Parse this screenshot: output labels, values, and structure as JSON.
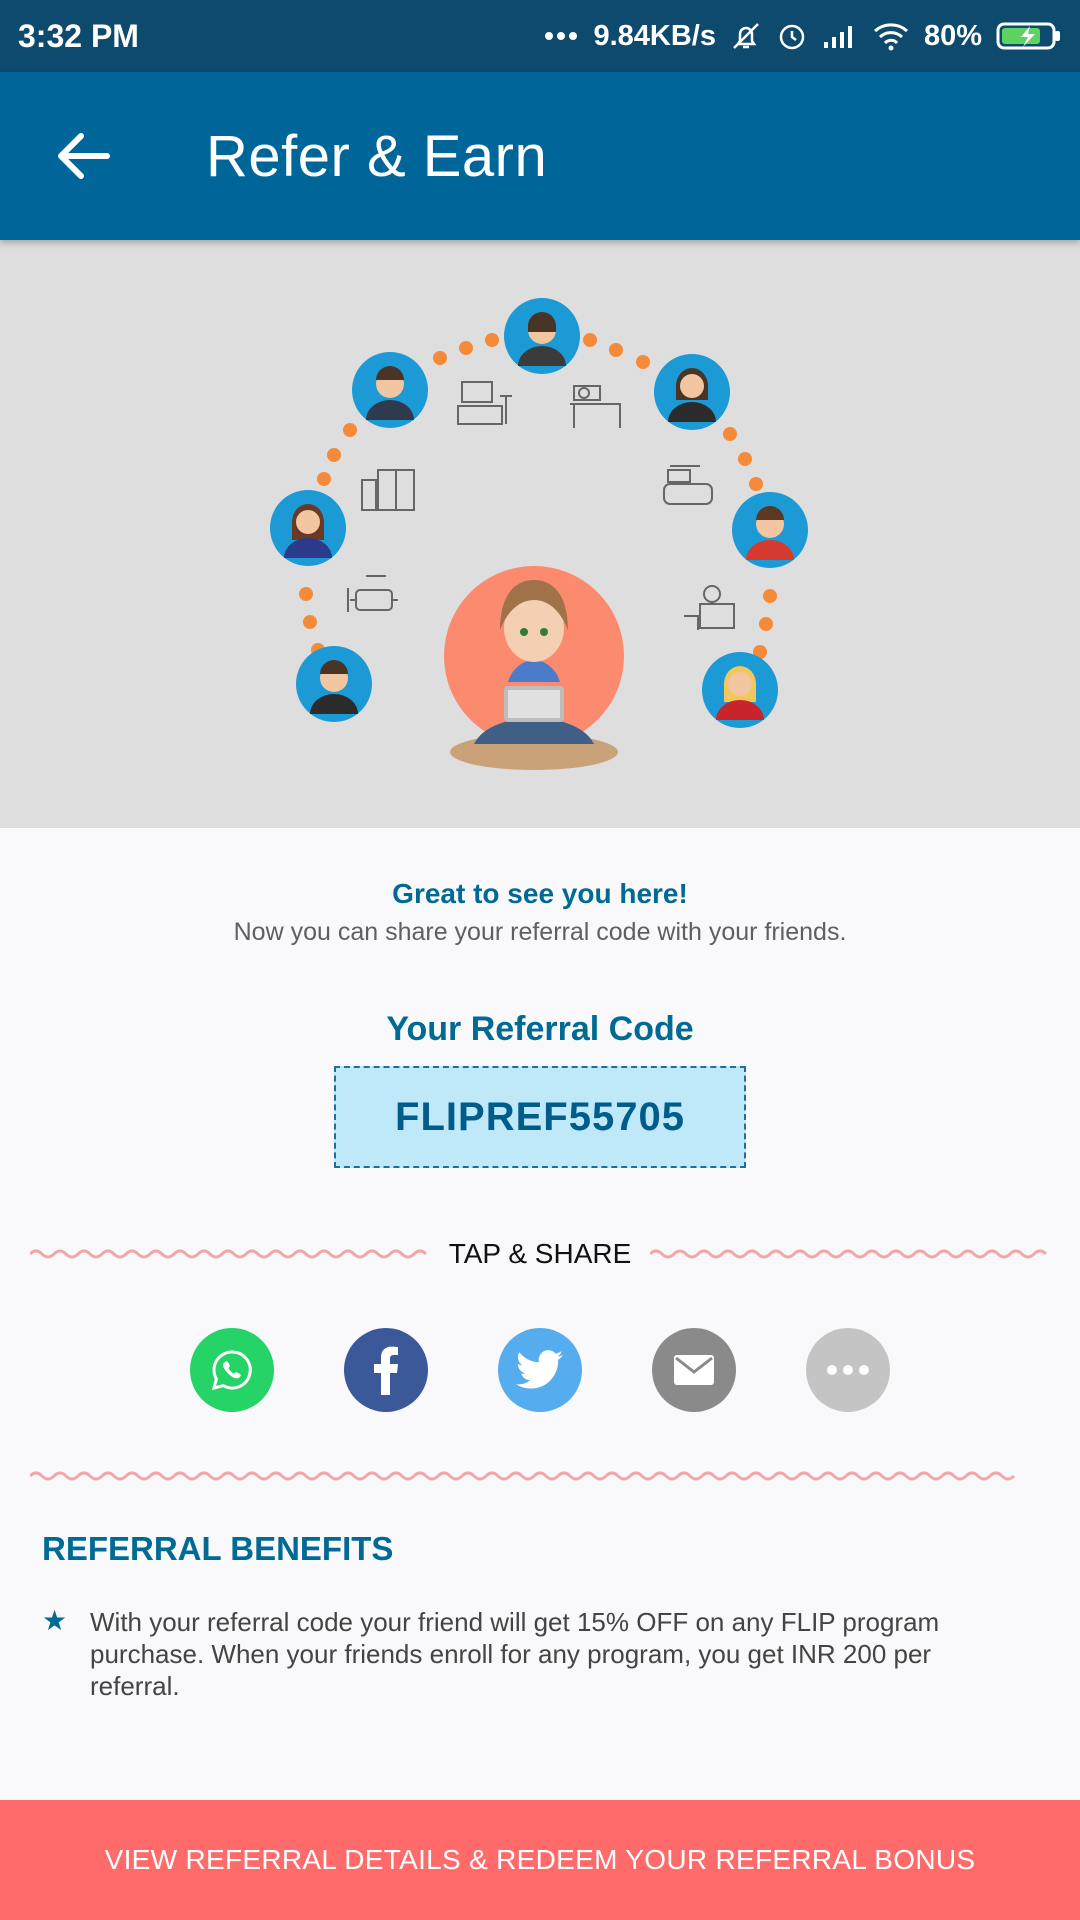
{
  "status_bar": {
    "time": "3:32 PM",
    "network_speed": "9.84KB/s",
    "battery": "80%",
    "icons": [
      "more-dots-icon",
      "muted-bell-icon",
      "alarm-icon",
      "signal-icon",
      "wifi-icon",
      "battery-charging-icon"
    ]
  },
  "app_bar": {
    "title": "Refer & Earn",
    "back_icon": "back-arrow-icon"
  },
  "greeting": {
    "title": "Great to see you here!",
    "subtitle": "Now you can share your referral code with your friends."
  },
  "referral": {
    "label": "Your Referral Code",
    "code": "FLIPREF55705"
  },
  "share": {
    "heading": "TAP & SHARE",
    "buttons": [
      {
        "icon": "whatsapp-icon",
        "color": "#25d366"
      },
      {
        "icon": "facebook-icon",
        "color": "#3b5998"
      },
      {
        "icon": "twitter-icon",
        "color": "#55acee"
      },
      {
        "icon": "email-icon",
        "color": "#8a8a8a"
      },
      {
        "icon": "more-icon",
        "color": "#c4c4c4"
      }
    ]
  },
  "benefits": {
    "title": "REFERRAL BENEFITS",
    "items": [
      "With your referral code your friend will get 15% OFF on any FLIP program purchase. When your friends enroll for any program, you get INR 200 per referral."
    ]
  },
  "cta": {
    "label": "VIEW REFERRAL DETAILS & REDEEM YOUR REFERRAL BONUS"
  },
  "colors": {
    "status_bar": "#0e4a6e",
    "app_bar": "#006699",
    "accent": "#006a94",
    "cta": "#ff6b6b",
    "code_box": "#bfe8f9",
    "wave": "#f4a6a6",
    "dots": "#f58a3a"
  }
}
